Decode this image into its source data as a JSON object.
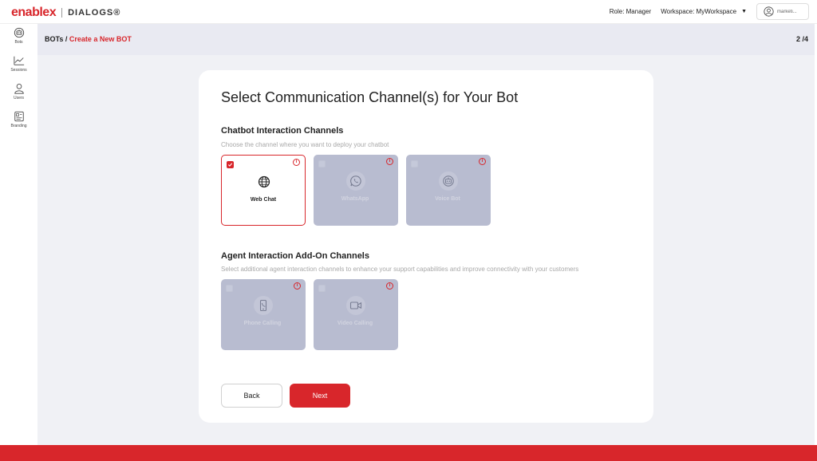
{
  "brand": {
    "logo_primary": "enablex",
    "logo_secondary": "DIALOGS®",
    "accent_color": "#d8262b"
  },
  "topbar": {
    "role": "Role: Manager",
    "workspace": "Workspace: MyWorkspace",
    "user_name": "marketi..."
  },
  "sidebar": {
    "items": [
      {
        "label": "Bots",
        "icon": "bot-icon"
      },
      {
        "label": "Sessions",
        "icon": "line-chart-icon"
      },
      {
        "label": "Users",
        "icon": "user-icon"
      },
      {
        "label": "Branding",
        "icon": "branding-icon"
      }
    ]
  },
  "subheader": {
    "breadcrumb_root": "BOTs",
    "breadcrumb_sep": " / ",
    "breadcrumb_current": "Create a New BOT",
    "step": "2 /4"
  },
  "card": {
    "title": "Select Communication Channel(s) for Your Bot",
    "chatbot_section": {
      "title": "Chatbot Interaction Channels",
      "subtitle": "Choose the channel where you want to deploy your chatbot",
      "channels": [
        {
          "label": "Web Chat",
          "icon": "globe-icon",
          "selected": true,
          "enabled": true
        },
        {
          "label": "WhatsApp",
          "icon": "whatsapp-icon",
          "selected": false,
          "enabled": false
        },
        {
          "label": "Voice Bot",
          "icon": "voice-bot-icon",
          "selected": false,
          "enabled": false
        }
      ]
    },
    "agent_section": {
      "title": "Agent Interaction Add-On Channels",
      "subtitle": "Select additional agent interaction channels to enhance your support capabilities and improve connectivity with your customers",
      "channels": [
        {
          "label": "Phone Calling",
          "icon": "phone-icon",
          "selected": false,
          "enabled": false
        },
        {
          "label": "Video Calling",
          "icon": "video-icon",
          "selected": false,
          "enabled": false
        }
      ]
    },
    "buttons": {
      "back": "Back",
      "next": "Next"
    }
  }
}
